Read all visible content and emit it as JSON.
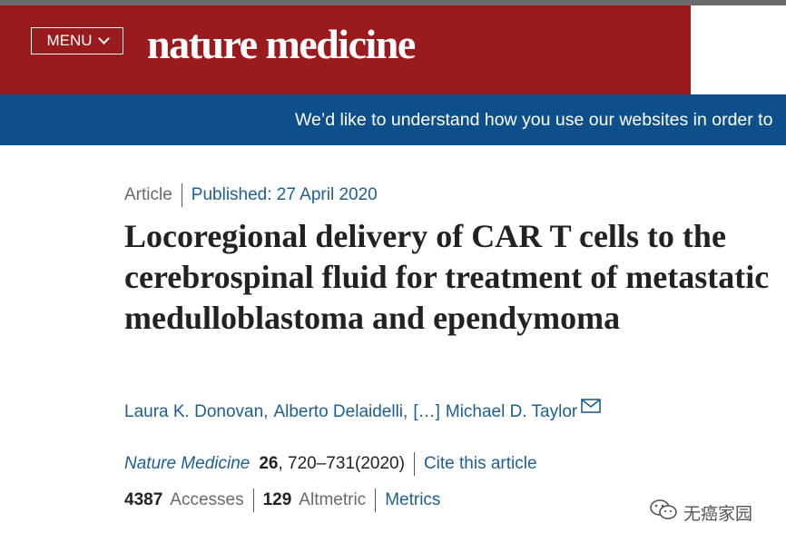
{
  "header": {
    "menu_label": "MENU",
    "brand": "nature medicine",
    "brand_color": "#9a1b1e"
  },
  "cookie_banner": {
    "text": "We’d like to understand how you use our websites in order to",
    "color": "#0d4f8b"
  },
  "article": {
    "type": "Article",
    "published": "Published: 27 April 2020",
    "title": "Locoregional delivery of CAR T cells to the cerebrospinal fluid for treatment of metastatic medulloblastoma and ependymoma",
    "authors": {
      "first": "Laura K. Donovan",
      "sep1": ",",
      "second": "Alberto Delaidelli",
      "sep2": ",",
      "more": "[…]",
      "last": "Michael D. Taylor",
      "icon": "mail-icon"
    },
    "citation": {
      "journal": "Nature Medicine",
      "volume": "26",
      "pages": ", 720–731(2020)",
      "cite_label": "Cite this article"
    },
    "metrics": {
      "accesses_count": "4387",
      "accesses_label": "Accesses",
      "altmetric_count": "129",
      "altmetric_label": "Altmetric",
      "metrics_link": "Metrics"
    }
  },
  "watermark": {
    "text": "无癌家园",
    "icon": "wechat-icon"
  }
}
